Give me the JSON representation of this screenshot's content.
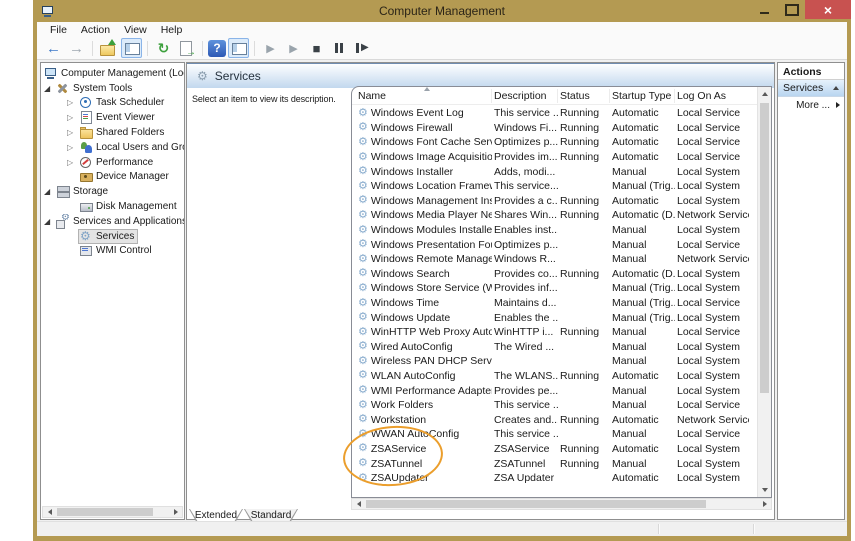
{
  "window": {
    "title": "Computer Management"
  },
  "menu": {
    "items": [
      {
        "label": "File",
        "name": "menu-file"
      },
      {
        "label": "Action",
        "name": "menu-action"
      },
      {
        "label": "View",
        "name": "menu-view"
      },
      {
        "label": "Help",
        "name": "menu-help"
      }
    ]
  },
  "toolbar": {
    "buttons": [
      {
        "name": "back-icon",
        "interactable": "true"
      },
      {
        "name": "forward-icon",
        "interactable": "true"
      },
      {
        "name": "separator",
        "interactable": "false"
      },
      {
        "name": "folder-up-icon",
        "interactable": "true"
      },
      {
        "name": "show-console-tree-icon",
        "interactable": "true"
      },
      {
        "name": "separator",
        "interactable": "false"
      },
      {
        "name": "refresh-icon",
        "interactable": "true"
      },
      {
        "name": "export-list-icon",
        "interactable": "true"
      },
      {
        "name": "separator",
        "interactable": "false"
      },
      {
        "name": "help-icon",
        "interactable": "true"
      },
      {
        "name": "show-actions-pane-icon",
        "interactable": "true"
      },
      {
        "name": "separator",
        "interactable": "false"
      },
      {
        "name": "start-service-icon",
        "interactable": "true"
      },
      {
        "name": "resume-service-icon",
        "interactable": "true"
      },
      {
        "name": "stop-service-icon",
        "interactable": "true"
      },
      {
        "name": "pause-service-icon",
        "interactable": "true"
      },
      {
        "name": "restart-service-icon",
        "interactable": "true"
      }
    ]
  },
  "tree": {
    "items": [
      {
        "name": "tree-item-computer-management",
        "label": "Computer Management (Local)",
        "icon": "computer-icon",
        "level": 0,
        "expander": "none"
      },
      {
        "name": "tree-item-system-tools",
        "label": "System Tools",
        "icon": "system-tools-icon",
        "level": 1,
        "expander": "expanded",
        "expander_icon": "collapse-icon"
      },
      {
        "name": "tree-item-task-scheduler",
        "label": "Task Scheduler",
        "icon": "task-scheduler-icon",
        "level": 2,
        "expander": "collapsed",
        "expander_icon": "expand-icon"
      },
      {
        "name": "tree-item-event-viewer",
        "label": "Event Viewer",
        "icon": "event-viewer-icon",
        "level": 2,
        "expander": "collapsed",
        "expander_icon": "expand-icon"
      },
      {
        "name": "tree-item-shared-folders",
        "label": "Shared Folders",
        "icon": "shared-folders-icon",
        "level": 2,
        "expander": "collapsed",
        "expander_icon": "expand-icon"
      },
      {
        "name": "tree-item-local-users-and-groups",
        "label": "Local Users and Groups",
        "icon": "users-groups-icon",
        "level": 2,
        "expander": "collapsed",
        "expander_icon": "expand-icon"
      },
      {
        "name": "tree-item-performance",
        "label": "Performance",
        "icon": "performance-icon",
        "level": 2,
        "expander": "collapsed",
        "expander_icon": "expand-icon"
      },
      {
        "name": "tree-item-device-manager",
        "label": "Device Manager",
        "icon": "device-manager-icon",
        "level": 2,
        "expander": "none"
      },
      {
        "name": "tree-item-storage",
        "label": "Storage",
        "icon": "storage-icon",
        "level": 1,
        "expander": "expanded",
        "expander_icon": "collapse-icon"
      },
      {
        "name": "tree-item-disk-management",
        "label": "Disk Management",
        "icon": "disk-management-icon",
        "level": 2,
        "expander": "none"
      },
      {
        "name": "tree-item-services-and-applications",
        "label": "Services and Applications",
        "icon": "services-apps-icon",
        "level": 1,
        "expander": "expanded",
        "expander_icon": "collapse-icon"
      },
      {
        "name": "tree-item-services",
        "label": "Services",
        "icon": "services-icon",
        "level": 2,
        "expander": "none",
        "selected": "true"
      },
      {
        "name": "tree-item-wmi-control",
        "label": "WMI Control",
        "icon": "wmi-control-icon",
        "level": 2,
        "expander": "none"
      }
    ]
  },
  "main": {
    "panel_title": "Services",
    "description_hint": "Select an item to view its description.",
    "sort_column": "Name",
    "columns": [
      "Name",
      "Description",
      "Status",
      "Startup Type",
      "Log On As"
    ],
    "rows": [
      {
        "name": "Windows Event Log",
        "description": "This service ...",
        "status": "Running",
        "startup_type": "Automatic",
        "log_on_as": "Local Service"
      },
      {
        "name": "Windows Firewall",
        "description": "Windows Fi...",
        "status": "Running",
        "startup_type": "Automatic",
        "log_on_as": "Local Service"
      },
      {
        "name": "Windows Font Cache Service",
        "description": "Optimizes p...",
        "status": "Running",
        "startup_type": "Automatic",
        "log_on_as": "Local Service"
      },
      {
        "name": "Windows Image Acquisitio...",
        "description": "Provides im...",
        "status": "Running",
        "startup_type": "Automatic",
        "log_on_as": "Local Service"
      },
      {
        "name": "Windows Installer",
        "description": "Adds, modi...",
        "status": "",
        "startup_type": "Manual",
        "log_on_as": "Local System"
      },
      {
        "name": "Windows Location Framew...",
        "description": "This service...",
        "status": "",
        "startup_type": "Manual (Trig...",
        "log_on_as": "Local System"
      },
      {
        "name": "Windows Management Inst...",
        "description": "Provides a c...",
        "status": "Running",
        "startup_type": "Automatic",
        "log_on_as": "Local System"
      },
      {
        "name": "Windows Media Player Net...",
        "description": "Shares Win...",
        "status": "Running",
        "startup_type": "Automatic (D...",
        "log_on_as": "Network Service"
      },
      {
        "name": "Windows Modules Installer",
        "description": "Enables inst...",
        "status": "",
        "startup_type": "Manual",
        "log_on_as": "Local System"
      },
      {
        "name": "Windows Presentation Fou...",
        "description": "Optimizes p...",
        "status": "",
        "startup_type": "Manual",
        "log_on_as": "Local Service"
      },
      {
        "name": "Windows Remote Manage...",
        "description": "Windows R...",
        "status": "",
        "startup_type": "Manual",
        "log_on_as": "Network Service"
      },
      {
        "name": "Windows Search",
        "description": "Provides co...",
        "status": "Running",
        "startup_type": "Automatic (D...",
        "log_on_as": "Local System"
      },
      {
        "name": "Windows Store Service (WS...",
        "description": "Provides inf...",
        "status": "",
        "startup_type": "Manual (Trig...",
        "log_on_as": "Local System"
      },
      {
        "name": "Windows Time",
        "description": "Maintains d...",
        "status": "",
        "startup_type": "Manual (Trig...",
        "log_on_as": "Local Service"
      },
      {
        "name": "Windows Update",
        "description": "Enables the ...",
        "status": "",
        "startup_type": "Manual (Trig...",
        "log_on_as": "Local System"
      },
      {
        "name": "WinHTTP Web Proxy Auto-...",
        "description": "WinHTTP i...",
        "status": "Running",
        "startup_type": "Manual",
        "log_on_as": "Local Service"
      },
      {
        "name": "Wired AutoConfig",
        "description": "The Wired ...",
        "status": "",
        "startup_type": "Manual",
        "log_on_as": "Local System"
      },
      {
        "name": "Wireless PAN DHCP Server",
        "description": "",
        "status": "",
        "startup_type": "Manual",
        "log_on_as": "Local System"
      },
      {
        "name": "WLAN AutoConfig",
        "description": "The WLANS...",
        "status": "Running",
        "startup_type": "Automatic",
        "log_on_as": "Local System"
      },
      {
        "name": "WMI Performance Adapter",
        "description": "Provides pe...",
        "status": "",
        "startup_type": "Manual",
        "log_on_as": "Local System"
      },
      {
        "name": "Work Folders",
        "description": "This service ...",
        "status": "",
        "startup_type": "Manual",
        "log_on_as": "Local Service"
      },
      {
        "name": "Workstation",
        "description": "Creates and...",
        "status": "Running",
        "startup_type": "Automatic",
        "log_on_as": "Network Service"
      },
      {
        "name": "WWAN AutoConfig",
        "description": "This service ...",
        "status": "",
        "startup_type": "Manual",
        "log_on_as": "Local Service"
      },
      {
        "name": "ZSAService",
        "description": "ZSAService",
        "status": "Running",
        "startup_type": "Automatic",
        "log_on_as": "Local System"
      },
      {
        "name": "ZSATunnel",
        "description": "ZSATunnel",
        "status": "Running",
        "startup_type": "Manual",
        "log_on_as": "Local System"
      },
      {
        "name": "ZSAUpdater",
        "description": "ZSA Updater",
        "status": "",
        "startup_type": "Automatic",
        "log_on_as": "Local System"
      }
    ],
    "tabs": [
      {
        "label": "Extended",
        "name": "tab-extended",
        "active": "true"
      },
      {
        "label": "Standard",
        "name": "tab-standard",
        "active": "false"
      }
    ]
  },
  "actions": {
    "title": "Actions",
    "section_title": "Services",
    "more_label": "More ..."
  },
  "colors": {
    "titlebar": "#b49a52",
    "window_border": "#b49a52",
    "close_button": "#c85250",
    "banner_start": "#fdfeff",
    "banner_end": "#c2d8ee",
    "selection_start": "#e6f2fc",
    "selection_end": "#b9d5f0",
    "highlight_ellipse": "#eb9e2c"
  }
}
